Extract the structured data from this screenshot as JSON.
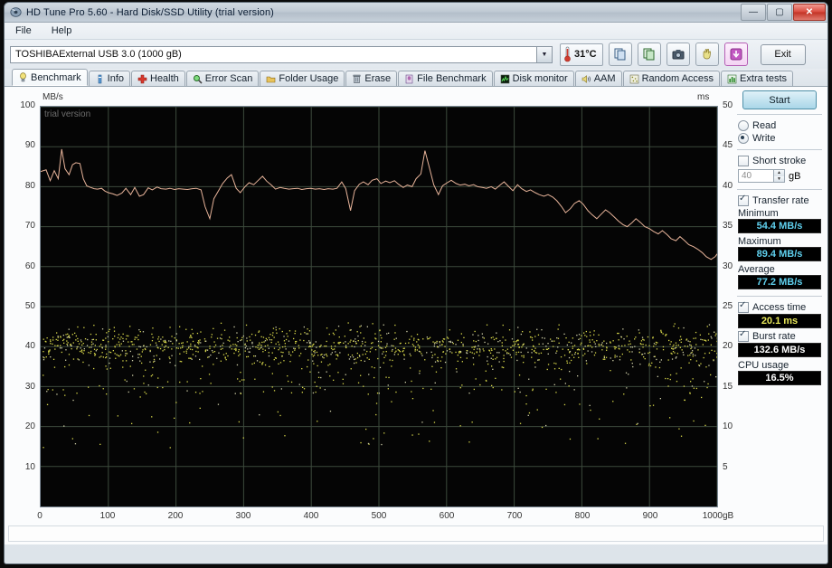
{
  "window": {
    "title": "HD Tune Pro 5.60 - Hard Disk/SSD Utility (trial version)",
    "minimize_label": "—",
    "maximize_label": "▢",
    "close_label": "✕"
  },
  "menu": {
    "items": [
      {
        "label": "File"
      },
      {
        "label": "Help"
      }
    ]
  },
  "toolbar": {
    "device": "TOSHIBAExternal USB 3.0 (1000 gB)",
    "temperature": "31°C",
    "exit_label": "Exit",
    "icons": [
      {
        "name": "copy-icon"
      },
      {
        "name": "copy-folder-icon"
      },
      {
        "name": "camera-icon"
      },
      {
        "name": "hand-icon"
      },
      {
        "name": "download-icon"
      }
    ]
  },
  "tabs": [
    {
      "label": "Benchmark",
      "icon": "lightbulb-icon",
      "active": true
    },
    {
      "label": "Info",
      "icon": "info-icon",
      "active": false
    },
    {
      "label": "Health",
      "icon": "health-cross-icon",
      "active": false
    },
    {
      "label": "Error Scan",
      "icon": "magnifier-icon",
      "active": false
    },
    {
      "label": "Folder Usage",
      "icon": "folder-icon",
      "active": false
    },
    {
      "label": "Erase",
      "icon": "trash-icon",
      "active": false
    },
    {
      "label": "File Benchmark",
      "icon": "file-bench-icon",
      "active": false
    },
    {
      "label": "Disk monitor",
      "icon": "disk-monitor-icon",
      "active": false
    },
    {
      "label": "AAM",
      "icon": "speaker-icon",
      "active": false
    },
    {
      "label": "Random Access",
      "icon": "random-access-icon",
      "active": false
    },
    {
      "label": "Extra tests",
      "icon": "extra-tests-icon",
      "active": false
    }
  ],
  "panel": {
    "start_label": "Start",
    "mode": {
      "read_label": "Read",
      "write_label": "Write",
      "selected": "Write"
    },
    "short_stroke": {
      "label": "Short stroke",
      "checked": false,
      "value": "40",
      "unit": "gB"
    },
    "transfer_rate": {
      "label": "Transfer rate",
      "checked": true
    },
    "minimum_label": "Minimum",
    "minimum_value": "54.4 MB/s",
    "maximum_label": "Maximum",
    "maximum_value": "89.4 MB/s",
    "average_label": "Average",
    "average_value": "77.2 MB/s",
    "access_time_label": "Access time",
    "access_time_checked": true,
    "access_time_value": "20.1 ms",
    "burst_rate_label": "Burst rate",
    "burst_rate_checked": true,
    "burst_rate_value": "132.6 MB/s",
    "cpu_usage_label": "CPU usage",
    "cpu_usage_value": "16.5%"
  },
  "chart_data": {
    "type": "line",
    "title": "",
    "watermark": "trial version",
    "xlabel": "",
    "ylabel": "MB/s",
    "y2label": "ms",
    "xlim": [
      0,
      1000
    ],
    "ylim": [
      0,
      100
    ],
    "y2lim": [
      0,
      50
    ],
    "xticks": [
      0,
      100,
      200,
      300,
      400,
      500,
      600,
      700,
      800,
      900,
      1000
    ],
    "xtick_labels": [
      "0",
      "100",
      "200",
      "300",
      "400",
      "500",
      "600",
      "700",
      "800",
      "900",
      "1000gB"
    ],
    "yticks": [
      10,
      20,
      30,
      40,
      50,
      60,
      70,
      80,
      90,
      100
    ],
    "y2ticks": [
      5,
      10,
      15,
      20,
      25,
      30,
      35,
      40,
      45,
      50
    ],
    "grid": true,
    "grid_color": "#3c4a3c",
    "plot_bg": "#050505",
    "series": [
      {
        "name": "Transfer rate",
        "type": "line",
        "color": "#e8b49a",
        "axis": "left",
        "x": [
          0,
          8,
          14,
          20,
          26,
          31,
          36,
          42,
          47,
          52,
          58,
          63,
          68,
          74,
          79,
          84,
          90,
          95,
          100,
          107,
          113,
          120,
          126,
          133,
          139,
          146,
          152,
          159,
          165,
          172,
          178,
          185,
          191,
          198,
          204,
          211,
          217,
          224,
          230,
          237,
          243,
          250,
          256,
          263,
          269,
          276,
          282,
          289,
          295,
          302,
          308,
          315,
          321,
          328,
          334,
          341,
          347,
          354,
          360,
          367,
          373,
          380,
          386,
          393,
          399,
          406,
          412,
          419,
          425,
          432,
          438,
          445,
          451,
          458,
          464,
          471,
          477,
          484,
          490,
          497,
          503,
          510,
          516,
          523,
          529,
          536,
          542,
          549,
          555,
          562,
          568,
          575,
          581,
          588,
          594,
          601,
          607,
          614,
          620,
          627,
          633,
          640,
          646,
          653,
          659,
          666,
          672,
          679,
          685,
          692,
          698,
          705,
          711,
          718,
          724,
          731,
          737,
          744,
          750,
          757,
          763,
          770,
          776,
          783,
          789,
          796,
          802,
          809,
          815,
          822,
          828,
          835,
          841,
          848,
          854,
          861,
          867,
          874,
          880,
          887,
          893,
          900,
          906,
          913,
          919,
          926,
          932,
          939,
          945,
          952,
          958,
          965,
          971,
          978,
          984,
          991,
          997,
          1000
        ],
        "y": [
          83.8,
          84.2,
          81.5,
          84.0,
          82.0,
          89.4,
          84.5,
          83.0,
          85.5,
          86.0,
          85.8,
          82.0,
          80.2,
          79.8,
          79.5,
          79.4,
          79.6,
          78.9,
          78.5,
          78.2,
          77.8,
          78.4,
          79.6,
          78.0,
          79.8,
          77.6,
          78.0,
          79.7,
          79.2,
          79.9,
          79.5,
          79.4,
          79.6,
          79.3,
          79.5,
          79.4,
          79.3,
          79.5,
          79.6,
          79.2,
          75.0,
          72.0,
          77.0,
          79.0,
          80.8,
          82.2,
          83.0,
          79.6,
          78.5,
          80.0,
          81.0,
          80.5,
          81.5,
          82.6,
          81.4,
          80.4,
          79.4,
          79.8,
          79.6,
          79.4,
          79.5,
          79.6,
          79.3,
          79.5,
          79.6,
          79.4,
          79.5,
          79.3,
          79.5,
          79.4,
          79.6,
          81.2,
          79.5,
          74.0,
          79.0,
          80.6,
          81.2,
          80.5,
          81.6,
          82.0,
          80.8,
          81.4,
          81.0,
          81.5,
          80.6,
          79.8,
          80.4,
          80.0,
          82.0,
          83.2,
          89.0,
          84.5,
          80.5,
          78.0,
          80.2,
          81.0,
          81.6,
          80.8,
          80.4,
          80.6,
          80.2,
          80.5,
          80.0,
          79.8,
          79.6,
          80.0,
          79.4,
          80.4,
          81.2,
          80.0,
          79.0,
          80.5,
          79.5,
          78.8,
          79.2,
          78.5,
          78.0,
          77.6,
          78.0,
          77.4,
          76.5,
          75.0,
          73.5,
          74.5,
          75.8,
          76.5,
          75.6,
          74.0,
          73.0,
          72.0,
          73.0,
          74.2,
          73.5,
          72.4,
          71.4,
          70.5,
          70.0,
          71.0,
          72.0,
          71.0,
          70.0,
          69.5,
          68.8,
          68.2,
          69.0,
          68.0,
          67.0,
          66.5,
          67.5,
          66.5,
          65.5,
          65.0,
          64.4,
          63.5,
          62.5,
          61.8,
          62.5,
          63.2,
          62.0,
          61.0,
          60.2,
          59.5,
          58.8,
          59.6,
          60.2,
          59.0,
          58.0,
          57.0,
          56.2,
          57.4,
          58.0,
          56.5,
          55.8,
          56.0
        ]
      },
      {
        "name": "Access time",
        "type": "scatter",
        "color": "#d8d84a",
        "axis": "right",
        "mean_ms": 20.1,
        "spread_ms": 2.2,
        "point_count": 1500,
        "note": "dense yellow scatter band centred near 20 ms with sparse outliers down to ~10 ms"
      }
    ]
  }
}
